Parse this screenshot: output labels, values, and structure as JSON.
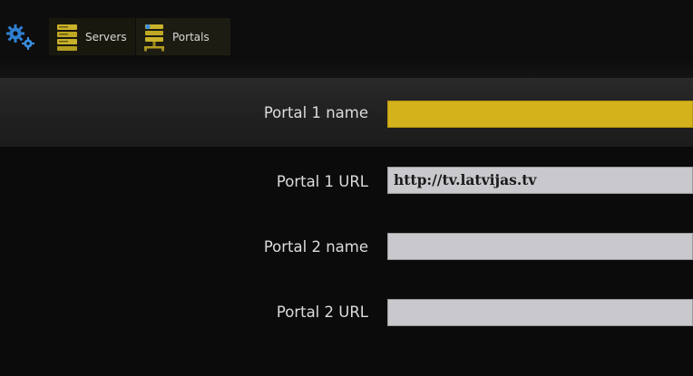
{
  "toolbar": {
    "settings_icon": "gears-icon",
    "tabs": [
      {
        "label": "Servers",
        "icon": "server-icon",
        "icon_color": "#c9b22a"
      },
      {
        "label": "Portals",
        "icon": "server-network-icon",
        "icon_color": "#c9b22a"
      }
    ]
  },
  "form": {
    "fields": [
      {
        "label": "Portal 1 name",
        "value": "",
        "focused": true
      },
      {
        "label": "Portal 1 URL",
        "value": "http://tv.latvijas.tv",
        "focused": false
      },
      {
        "label": "Portal 2 name",
        "value": "",
        "focused": false
      },
      {
        "label": "Portal 2 URL",
        "value": "",
        "focused": false
      }
    ]
  },
  "colors": {
    "accent": "#d4b21c",
    "background": "#0b0b0b",
    "selected_row": "#262626",
    "field_background": "#c9c9cd",
    "settings_icon": "#2f7fd0"
  }
}
